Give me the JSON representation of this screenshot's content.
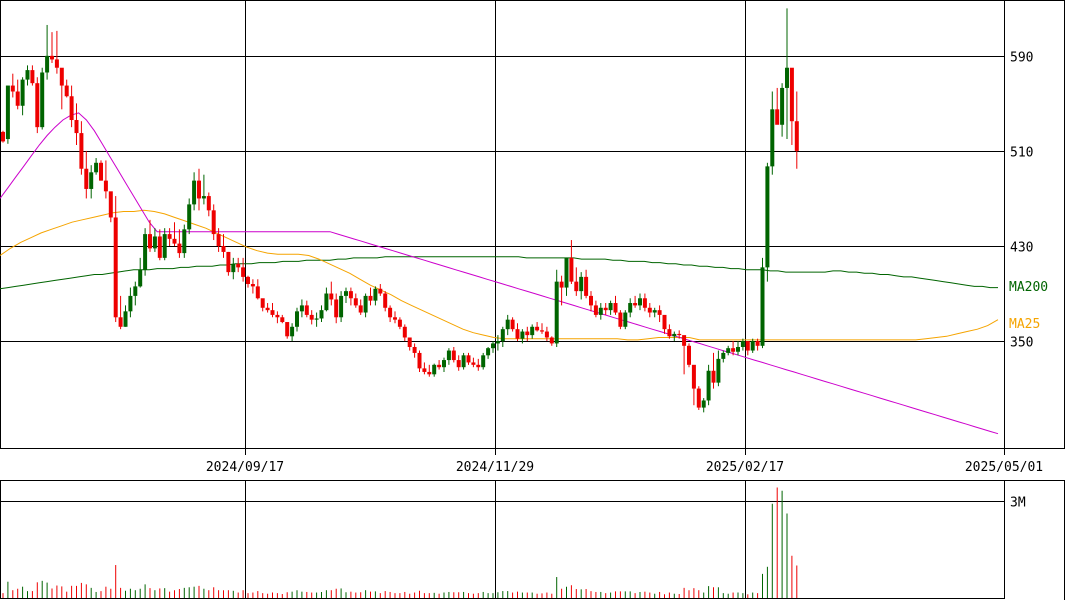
{
  "chart_data": {
    "type": "candlestick",
    "price_axis": {
      "range": [
        260,
        637
      ],
      "ticks": [
        590,
        510,
        430,
        350
      ]
    },
    "x_axis": {
      "date_labels": [
        "2024/09/17",
        "2024/11/29",
        "2025/02/17",
        "2025/05/01"
      ]
    },
    "volume_axis": {
      "range": [
        0,
        3600000
      ],
      "ticks": [
        3000000
      ],
      "tick_labels": [
        "3M"
      ]
    },
    "moving_averages": [
      {
        "name": "MA200",
        "color": "#006400"
      },
      {
        "name": "MA25",
        "color": "#f5a400"
      }
    ],
    "ma_line_colors": {
      "ma200": "#006400",
      "ma100": "#f5a400",
      "ma25": "#cc00cc"
    },
    "candle_colors": {
      "up": "#006400",
      "down": "#ee0000"
    },
    "grid": true,
    "candles_ohlc": [
      [
        526,
        527,
        517,
        518
      ],
      [
        520,
        565,
        516,
        565
      ],
      [
        565,
        575,
        555,
        560
      ],
      [
        560,
        570,
        545,
        548
      ],
      [
        548,
        572,
        540,
        570
      ],
      [
        570,
        582,
        565,
        578
      ],
      [
        578,
        582,
        565,
        567
      ],
      [
        567,
        572,
        525,
        530
      ],
      [
        530,
        580,
        528,
        576
      ],
      [
        576,
        616,
        570,
        590
      ],
      [
        590,
        610,
        584,
        587
      ],
      [
        587,
        611,
        575,
        580
      ],
      [
        580,
        578,
        545,
        565
      ],
      [
        565,
        570,
        555,
        556
      ],
      [
        556,
        565,
        530,
        536
      ],
      [
        536,
        550,
        515,
        525
      ],
      [
        525,
        535,
        490,
        495
      ],
      [
        495,
        510,
        470,
        478
      ],
      [
        478,
        498,
        470,
        492
      ],
      [
        492,
        504,
        490,
        500
      ],
      [
        500,
        502,
        485,
        485
      ],
      [
        485,
        502,
        470,
        476
      ],
      [
        476,
        475,
        450,
        454
      ],
      [
        454,
        472,
        366,
        370
      ],
      [
        370,
        388,
        360,
        362
      ],
      [
        362,
        380,
        362,
        375
      ],
      [
        375,
        395,
        370,
        388
      ],
      [
        388,
        400,
        380,
        396
      ],
      [
        396,
        420,
        395,
        410
      ],
      [
        410,
        445,
        405,
        440
      ],
      [
        440,
        452,
        425,
        428
      ],
      [
        428,
        445,
        425,
        438
      ],
      [
        438,
        444,
        418,
        420
      ],
      [
        420,
        445,
        418,
        440
      ],
      [
        440,
        445,
        430,
        436
      ],
      [
        436,
        450,
        430,
        432
      ],
      [
        432,
        444,
        420,
        424
      ],
      [
        424,
        448,
        420,
        444
      ],
      [
        444,
        470,
        440,
        465
      ],
      [
        465,
        492,
        460,
        485
      ],
      [
        485,
        495,
        460,
        470
      ],
      [
        470,
        490,
        465,
        472
      ],
      [
        472,
        475,
        455,
        460
      ],
      [
        460,
        465,
        435,
        440
      ],
      [
        440,
        445,
        425,
        430
      ],
      [
        430,
        440,
        420,
        425
      ],
      [
        425,
        425,
        405,
        408
      ],
      [
        408,
        420,
        402,
        415
      ],
      [
        415,
        420,
        408,
        412
      ],
      [
        412,
        420,
        400,
        404
      ],
      [
        404,
        405,
        395,
        398
      ],
      [
        398,
        402,
        390,
        396
      ],
      [
        396,
        402,
        385,
        386
      ],
      [
        386,
        385,
        375,
        378
      ],
      [
        378,
        382,
        374,
        376
      ],
      [
        376,
        382,
        370,
        372
      ],
      [
        372,
        375,
        365,
        370
      ],
      [
        370,
        372,
        365,
        366
      ],
      [
        366,
        365,
        352,
        354
      ],
      [
        354,
        365,
        350,
        362
      ],
      [
        362,
        378,
        358,
        375
      ],
      [
        375,
        385,
        370,
        380
      ],
      [
        380,
        384,
        370,
        372
      ],
      [
        372,
        376,
        364,
        368
      ],
      [
        368,
        374,
        362,
        369
      ],
      [
        369,
        380,
        366,
        376
      ],
      [
        376,
        395,
        375,
        390
      ],
      [
        390,
        400,
        380,
        385
      ],
      [
        385,
        390,
        365,
        370
      ],
      [
        370,
        392,
        366,
        388
      ],
      [
        388,
        395,
        382,
        392
      ],
      [
        392,
        395,
        380,
        386
      ],
      [
        386,
        390,
        378,
        380
      ],
      [
        380,
        385,
        372,
        374
      ],
      [
        374,
        390,
        370,
        388
      ],
      [
        388,
        395,
        380,
        384
      ],
      [
        384,
        396,
        380,
        394
      ],
      [
        394,
        398,
        388,
        390
      ],
      [
        390,
        392,
        375,
        378
      ],
      [
        378,
        380,
        366,
        370
      ],
      [
        370,
        375,
        365,
        368
      ],
      [
        368,
        370,
        360,
        362
      ],
      [
        362,
        364,
        350,
        353
      ],
      [
        353,
        350,
        342,
        345
      ],
      [
        345,
        348,
        336,
        340
      ],
      [
        340,
        342,
        324,
        327
      ],
      [
        327,
        332,
        322,
        324
      ],
      [
        324,
        330,
        320,
        322
      ],
      [
        322,
        331,
        320,
        330
      ],
      [
        330,
        334,
        326,
        328
      ],
      [
        328,
        336,
        324,
        334
      ],
      [
        334,
        344,
        330,
        342
      ],
      [
        342,
        345,
        332,
        334
      ],
      [
        334,
        338,
        325,
        328
      ],
      [
        328,
        340,
        326,
        338
      ],
      [
        338,
        340,
        330,
        332
      ],
      [
        332,
        336,
        328,
        330
      ],
      [
        330,
        335,
        325,
        328
      ],
      [
        328,
        340,
        326,
        338
      ],
      [
        338,
        345,
        335,
        344
      ],
      [
        344,
        350,
        340,
        348
      ],
      [
        348,
        355,
        342,
        350
      ],
      [
        350,
        362,
        345,
        360
      ],
      [
        360,
        372,
        355,
        368
      ],
      [
        368,
        370,
        358,
        360
      ],
      [
        360,
        365,
        350,
        352
      ],
      [
        352,
        360,
        348,
        358
      ],
      [
        358,
        362,
        350,
        355
      ],
      [
        355,
        364,
        352,
        362
      ],
      [
        362,
        366,
        358,
        359
      ],
      [
        359,
        365,
        356,
        358
      ],
      [
        358,
        362,
        350,
        353
      ],
      [
        353,
        354,
        346,
        348
      ],
      [
        348,
        410,
        345,
        400
      ],
      [
        400,
        405,
        380,
        395
      ],
      [
        395,
        420,
        388,
        420
      ],
      [
        420,
        435,
        398,
        400
      ],
      [
        400,
        412,
        388,
        392
      ],
      [
        392,
        408,
        385,
        404
      ],
      [
        404,
        410,
        386,
        388
      ],
      [
        388,
        392,
        375,
        380
      ],
      [
        380,
        384,
        370,
        372
      ],
      [
        372,
        382,
        368,
        378
      ],
      [
        378,
        382,
        372,
        376
      ],
      [
        376,
        384,
        372,
        382
      ],
      [
        382,
        388,
        372,
        374
      ],
      [
        374,
        376,
        360,
        362
      ],
      [
        362,
        376,
        360,
        374
      ],
      [
        374,
        386,
        370,
        382
      ],
      [
        382,
        388,
        378,
        380
      ],
      [
        380,
        390,
        376,
        386
      ],
      [
        386,
        390,
        375,
        378
      ],
      [
        378,
        382,
        370,
        374
      ],
      [
        374,
        378,
        370,
        376
      ],
      [
        376,
        380,
        366,
        372
      ],
      [
        372,
        362,
        356,
        360
      ],
      [
        360,
        364,
        352,
        354
      ],
      [
        354,
        358,
        350,
        356
      ],
      [
        356,
        359,
        352,
        355
      ],
      [
        355,
        350,
        322,
        346
      ],
      [
        346,
        348,
        328,
        330
      ],
      [
        330,
        323,
        296,
        310
      ],
      [
        310,
        312,
        292,
        294
      ],
      [
        294,
        302,
        290,
        300
      ],
      [
        300,
        330,
        296,
        325
      ],
      [
        325,
        340,
        310,
        315
      ],
      [
        315,
        342,
        312,
        335
      ],
      [
        335,
        342,
        332,
        340
      ],
      [
        340,
        346,
        338,
        344
      ],
      [
        344,
        350,
        338,
        341
      ],
      [
        341,
        350,
        338,
        345
      ],
      [
        345,
        352,
        342,
        350
      ],
      [
        350,
        344,
        338,
        342
      ],
      [
        342,
        352,
        340,
        350
      ],
      [
        350,
        352,
        342,
        346
      ],
      [
        346,
        420,
        344,
        412
      ],
      [
        412,
        500,
        400,
        497
      ],
      [
        497,
        560,
        490,
        545
      ],
      [
        545,
        563,
        535,
        532
      ],
      [
        532,
        567,
        522,
        563
      ],
      [
        563,
        630,
        520,
        580
      ],
      [
        580,
        570,
        515,
        535
      ],
      [
        535,
        560,
        495,
        510
      ]
    ],
    "ma200": [
      394,
      395,
      396,
      397,
      398,
      399,
      400,
      401,
      402,
      403,
      404,
      405,
      406,
      406,
      407,
      408,
      409,
      410,
      410,
      410,
      411,
      411,
      411,
      412,
      412,
      413,
      413,
      413,
      414,
      414,
      415,
      415,
      415,
      416,
      416,
      416,
      417,
      417,
      417,
      418,
      418,
      418,
      418,
      419,
      419,
      420,
      420,
      420,
      420,
      421,
      421,
      421,
      421,
      421,
      421,
      421,
      421,
      421,
      421,
      421,
      421,
      421,
      421,
      421,
      421,
      421,
      421,
      420,
      420,
      420,
      420,
      420,
      420,
      420,
      419,
      419,
      419,
      419,
      418,
      418,
      417,
      417,
      417,
      416,
      416,
      415,
      415,
      414,
      414,
      413,
      413,
      412,
      412,
      411,
      411,
      410,
      410,
      410,
      409,
      409,
      408,
      408,
      408,
      408,
      408,
      408,
      409,
      409,
      408,
      408,
      407,
      407,
      406,
      406,
      405,
      404,
      404,
      403,
      402,
      401,
      400,
      399,
      398,
      397,
      396,
      396,
      395,
      395
    ],
    "ma100": [
      422,
      428,
      433,
      437,
      441,
      444,
      447,
      450,
      452,
      454,
      456,
      458,
      459,
      459,
      460,
      459,
      457,
      454,
      451,
      448,
      445,
      441,
      437,
      433,
      429,
      426,
      424,
      423,
      423,
      423,
      422,
      419,
      415,
      411,
      407,
      402,
      397,
      393,
      389,
      384,
      380,
      376,
      372,
      368,
      364,
      360,
      357,
      355,
      353,
      352,
      352,
      352,
      352,
      352,
      352,
      352,
      352,
      352,
      352,
      352,
      352,
      351,
      351,
      352,
      353,
      353,
      353,
      353,
      351,
      351,
      351,
      351,
      351,
      351,
      351,
      351,
      351,
      351,
      351,
      351,
      351,
      351,
      351,
      351,
      351,
      351,
      351,
      351,
      351,
      351,
      352,
      353,
      354,
      356,
      358,
      360,
      363,
      368
    ],
    "ma25": [
      470,
      479,
      488,
      497,
      506,
      515,
      523,
      530,
      536,
      540,
      542,
      536,
      527,
      516,
      505,
      494,
      483,
      472,
      461,
      450,
      442,
      442,
      442,
      442,
      442,
      442,
      442,
      442,
      442,
      442,
      442,
      442,
      442,
      442,
      442,
      442,
      442,
      442,
      442,
      442,
      442,
      442,
      442,
      440,
      438,
      436,
      434,
      432,
      430,
      428,
      426,
      424,
      422,
      420,
      418,
      416,
      414,
      412,
      410,
      408,
      406,
      404,
      402,
      400,
      398,
      396,
      394,
      392,
      390,
      388,
      386,
      384,
      382,
      380,
      378,
      376,
      374,
      372,
      370,
      368,
      366,
      364,
      362,
      360,
      358,
      356,
      354,
      352,
      350,
      348,
      346,
      344,
      342,
      340,
      338,
      336,
      334,
      332,
      330,
      328,
      326,
      324,
      322,
      320,
      318,
      316,
      314,
      312,
      310,
      308,
      306,
      304,
      302,
      300,
      298,
      296,
      294,
      292,
      290,
      288,
      286,
      284,
      282,
      280,
      278,
      276,
      274,
      272
    ]
  }
}
